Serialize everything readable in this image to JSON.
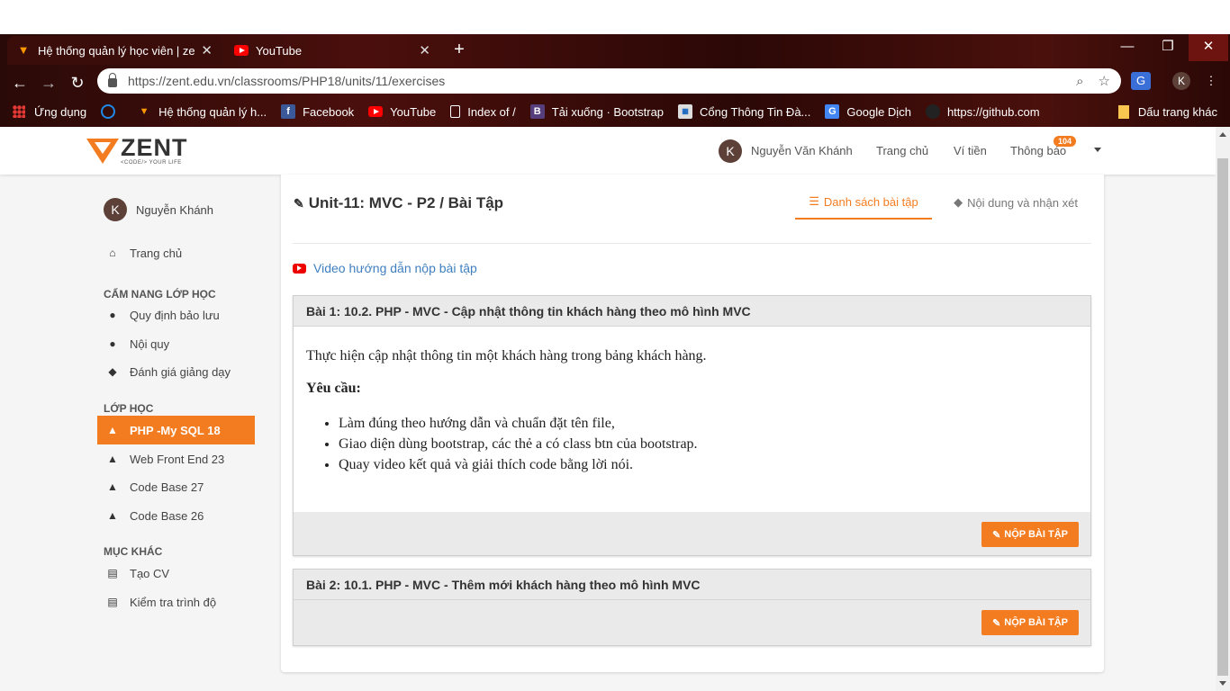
{
  "browser": {
    "tabs": [
      {
        "title": "Hệ thống quản lý học viên | zent"
      },
      {
        "title": "YouTube"
      }
    ],
    "url": "https://zent.edu.vn/classrooms/PHP18/units/11/exercises",
    "profile_initial": "K",
    "bookmarks": [
      {
        "label": "Ứng dụng"
      },
      {
        "label": ""
      },
      {
        "label": "Hệ thống quản lý h..."
      },
      {
        "label": "Facebook"
      },
      {
        "label": "YouTube"
      },
      {
        "label": "Index of /"
      },
      {
        "label": "Tải xuống · Bootstrap"
      },
      {
        "label": "Cổng Thông Tin Đà..."
      },
      {
        "label": "Google Dịch"
      },
      {
        "label": "https://github.com"
      }
    ],
    "other_bookmarks": "Dấu trang khác"
  },
  "header": {
    "logo_text": "ZENT",
    "logo_tagline": "<CODE/> YOUR LIFE",
    "user_initial": "K",
    "user_name": "Nguyễn Văn Khánh",
    "nav_home": "Trang chủ",
    "nav_wallet": "Ví tiền",
    "nav_notifications": "Thông báo",
    "notification_count": "104"
  },
  "sidebar": {
    "user_initial": "K",
    "user_name": "Nguyễn Khánh",
    "home": "Trang chủ",
    "section_handbook": "CẨM NANG LỚP HỌC",
    "handbook_items": [
      {
        "label": "Quy định bảo lưu"
      },
      {
        "label": "Nội quy"
      },
      {
        "label": "Đánh giá giảng dạy"
      }
    ],
    "section_classes": "LỚP HỌC",
    "classes": [
      {
        "label": "PHP -My SQL 18"
      },
      {
        "label": "Web Front End 23"
      },
      {
        "label": "Code Base 27"
      },
      {
        "label": "Code Base 26"
      }
    ],
    "section_other": "MỤC KHÁC",
    "other_items": [
      {
        "label": "Tạo CV"
      },
      {
        "label": "Kiểm tra trình độ"
      }
    ]
  },
  "main": {
    "title": "Unit-11: MVC - P2 / Bài Tập",
    "tab_list": "Danh sách bài tập",
    "tab_comments": "Nội dung và nhận xét",
    "video_link": "Video hướng dẫn nộp bài tập",
    "exercises": [
      {
        "title": "Bài 1: 10.2. PHP - MVC - Cập nhật thông tin khách hàng theo mô hình MVC",
        "description": "Thực hiện cập nhật thông tin một khách hàng trong bảng khách hàng.",
        "requirements_label": "Yêu cầu:",
        "requirements": [
          "Làm đúng theo hướng dẫn và chuẩn đặt tên file,",
          "Giao diện dùng bootstrap, các thẻ a có class btn của bootstrap.",
          "Quay video kết quả và giải thích code bằng lời nói."
        ],
        "submit_label": "NỘP BÀI TẬP"
      },
      {
        "title": "Bài 2: 10.1. PHP - MVC - Thêm mới khách hàng theo mô hình MVC",
        "submit_label": "NỘP BÀI TẬP"
      }
    ]
  },
  "colors": {
    "accent": "#f47c20",
    "link": "#3f7fbf"
  }
}
